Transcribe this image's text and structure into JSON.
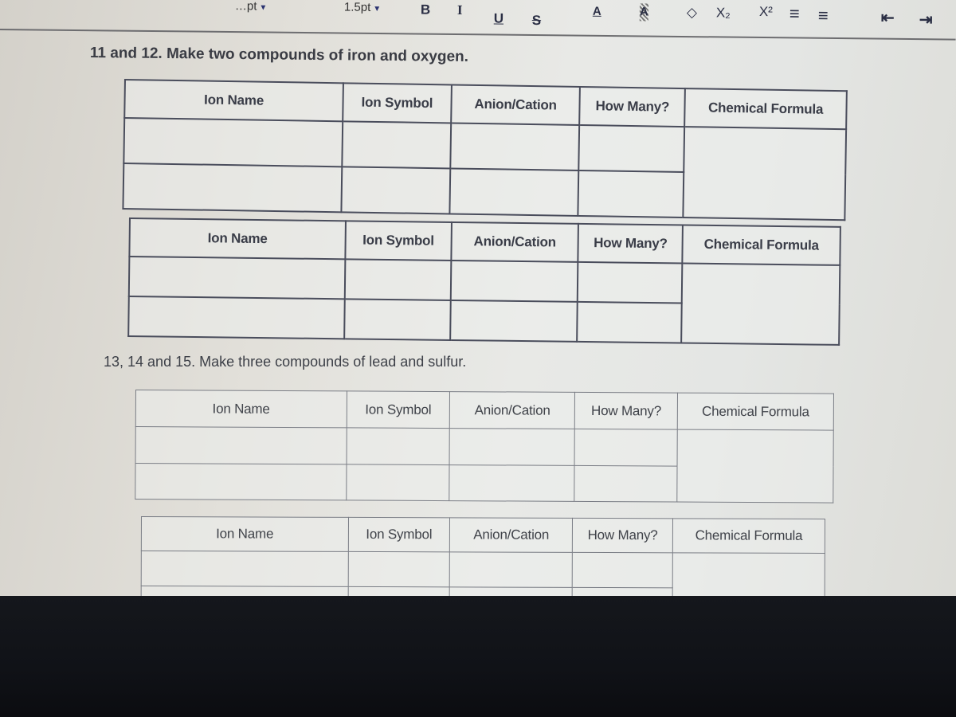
{
  "toolbar": {
    "font_size_value": "…pt",
    "line_width_value": "1.5pt",
    "buttons": [
      {
        "name": "bold-icon",
        "glyph": "B"
      },
      {
        "name": "italic-icon",
        "glyph": "I"
      },
      {
        "name": "underline-icon",
        "glyph": "U"
      },
      {
        "name": "strikethrough-icon",
        "glyph": "S"
      },
      {
        "name": "font-color-icon",
        "glyph": "A"
      },
      {
        "name": "highlight-color-icon",
        "glyph": "A"
      },
      {
        "name": "clear-formatting-icon",
        "glyph": "◇"
      },
      {
        "name": "subscript-icon",
        "glyph": "X₂"
      },
      {
        "name": "superscript-icon",
        "glyph": "X²"
      },
      {
        "name": "ordered-list-icon",
        "glyph": "≡"
      },
      {
        "name": "unordered-list-icon",
        "glyph": "≡"
      },
      {
        "name": "outdent-icon",
        "glyph": "⇤"
      },
      {
        "name": "indent-icon",
        "glyph": "⇥"
      }
    ]
  },
  "sections": [
    {
      "question": "11 and 12. Make two compounds of iron and oxygen.",
      "tables": [
        {
          "headers": [
            "Ion Name",
            "Ion Symbol",
            "Anion/Cation",
            "How Many?",
            "Chemical Formula"
          ],
          "rows": [
            [
              "",
              "",
              "",
              ""
            ],
            [
              "",
              "",
              "",
              ""
            ]
          ],
          "formula": ""
        },
        {
          "headers": [
            "Ion Name",
            "Ion Symbol",
            "Anion/Cation",
            "How Many?",
            "Chemical Formula"
          ],
          "rows": [
            [
              "",
              "",
              "",
              ""
            ],
            [
              "",
              "",
              "",
              ""
            ]
          ],
          "formula": ""
        }
      ]
    },
    {
      "question": "13, 14 and 15. Make three compounds of lead and sulfur.",
      "tables": [
        {
          "headers": [
            "Ion Name",
            "Ion Symbol",
            "Anion/Cation",
            "How Many?",
            "Chemical Formula"
          ],
          "rows": [
            [
              "",
              "",
              "",
              ""
            ],
            [
              "",
              "",
              "",
              ""
            ]
          ],
          "formula": ""
        },
        {
          "headers": [
            "Ion Name",
            "Ion Symbol",
            "Anion/Cation",
            "How Many?",
            "Chemical Formula"
          ],
          "rows": [
            [
              "",
              "",
              "",
              ""
            ],
            [
              "",
              "",
              "",
              ""
            ]
          ],
          "formula": ""
        }
      ]
    }
  ]
}
